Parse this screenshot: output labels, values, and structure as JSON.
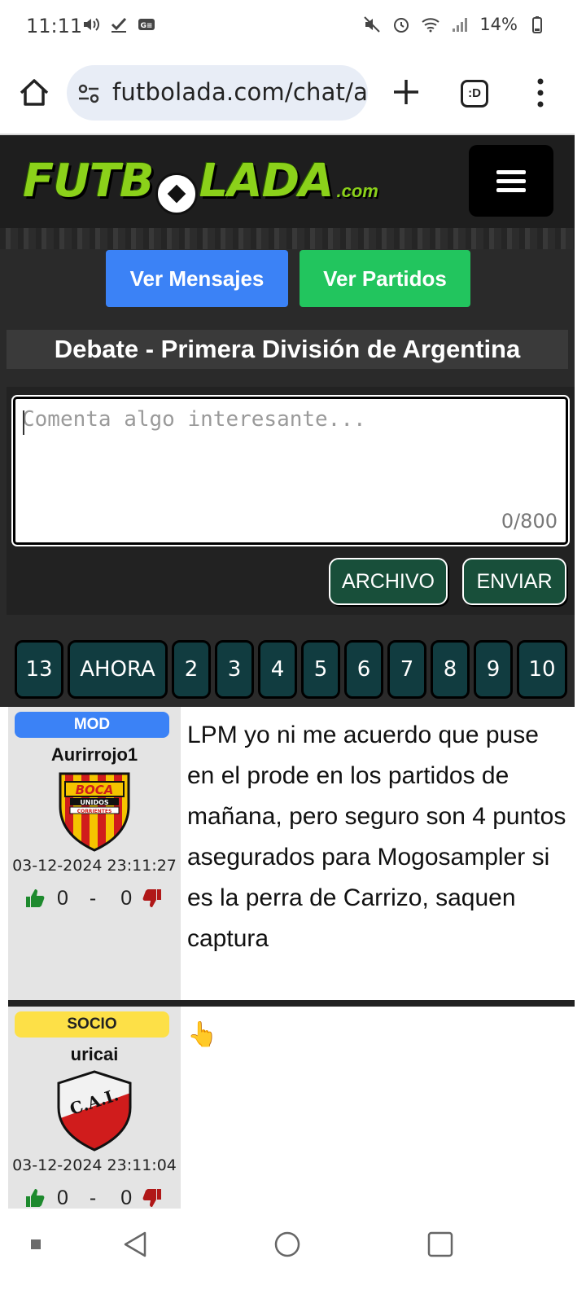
{
  "status_bar": {
    "time": "11:11",
    "battery": "14%",
    "left_icons": [
      "volume-icon",
      "check-icon",
      "caption-icon"
    ],
    "right_icons": [
      "mute-icon",
      "alarm-icon",
      "wifi-icon",
      "signal-icon",
      "battery-icon"
    ]
  },
  "browser": {
    "url": "futbolada.com/chat/ar",
    "tabs_label": ":D"
  },
  "site": {
    "logo_text_1": "FUTB",
    "logo_text_2": "LADA",
    "logo_suffix": ".com",
    "btn_messages": "Ver Mensajes",
    "btn_matches": "Ver Partidos",
    "debate_title": "Debate - Primera División de Argentina"
  },
  "composer": {
    "placeholder": "Comenta algo interesante...",
    "char_count": "0/800",
    "file_label": "ARCHIVO",
    "send_label": "ENVIAR"
  },
  "pagination": [
    "13",
    "AHORA",
    "2",
    "3",
    "4",
    "5",
    "6",
    "7",
    "8",
    "9",
    "10"
  ],
  "messages": [
    {
      "role": "MOD",
      "username": "Aurirrojo1",
      "crest_text_1": "BOCA",
      "crest_text_2": "UNIDOS",
      "crest_text_3": "CORRIENTES",
      "date": "03-12-2024 23:11:27",
      "likes": "0",
      "separator": "-",
      "dislikes": "0",
      "text": "LPM yo ni me acuerdo que puse en el prode en los partidos de mañana, pero seguro son 4 puntos asegurados para Mogosampler si es la perra de Carrizo, saquen captura"
    },
    {
      "role": "SOCIO",
      "username": "uricai",
      "crest_text_1": "C.A.I.",
      "date": "03-12-2024 23:11:04",
      "likes": "0",
      "separator": "-",
      "dislikes": "0",
      "text": "👆"
    }
  ],
  "colors": {
    "header_bg": "#1e1e1e",
    "logo_green": "#8bd11a",
    "blue": "#3b82f6",
    "green": "#22c55e",
    "dark_green_btn": "#184f3a",
    "page_btn": "#113c40",
    "mod_badge": "#3b82f6",
    "socio_badge": "#fde047"
  }
}
